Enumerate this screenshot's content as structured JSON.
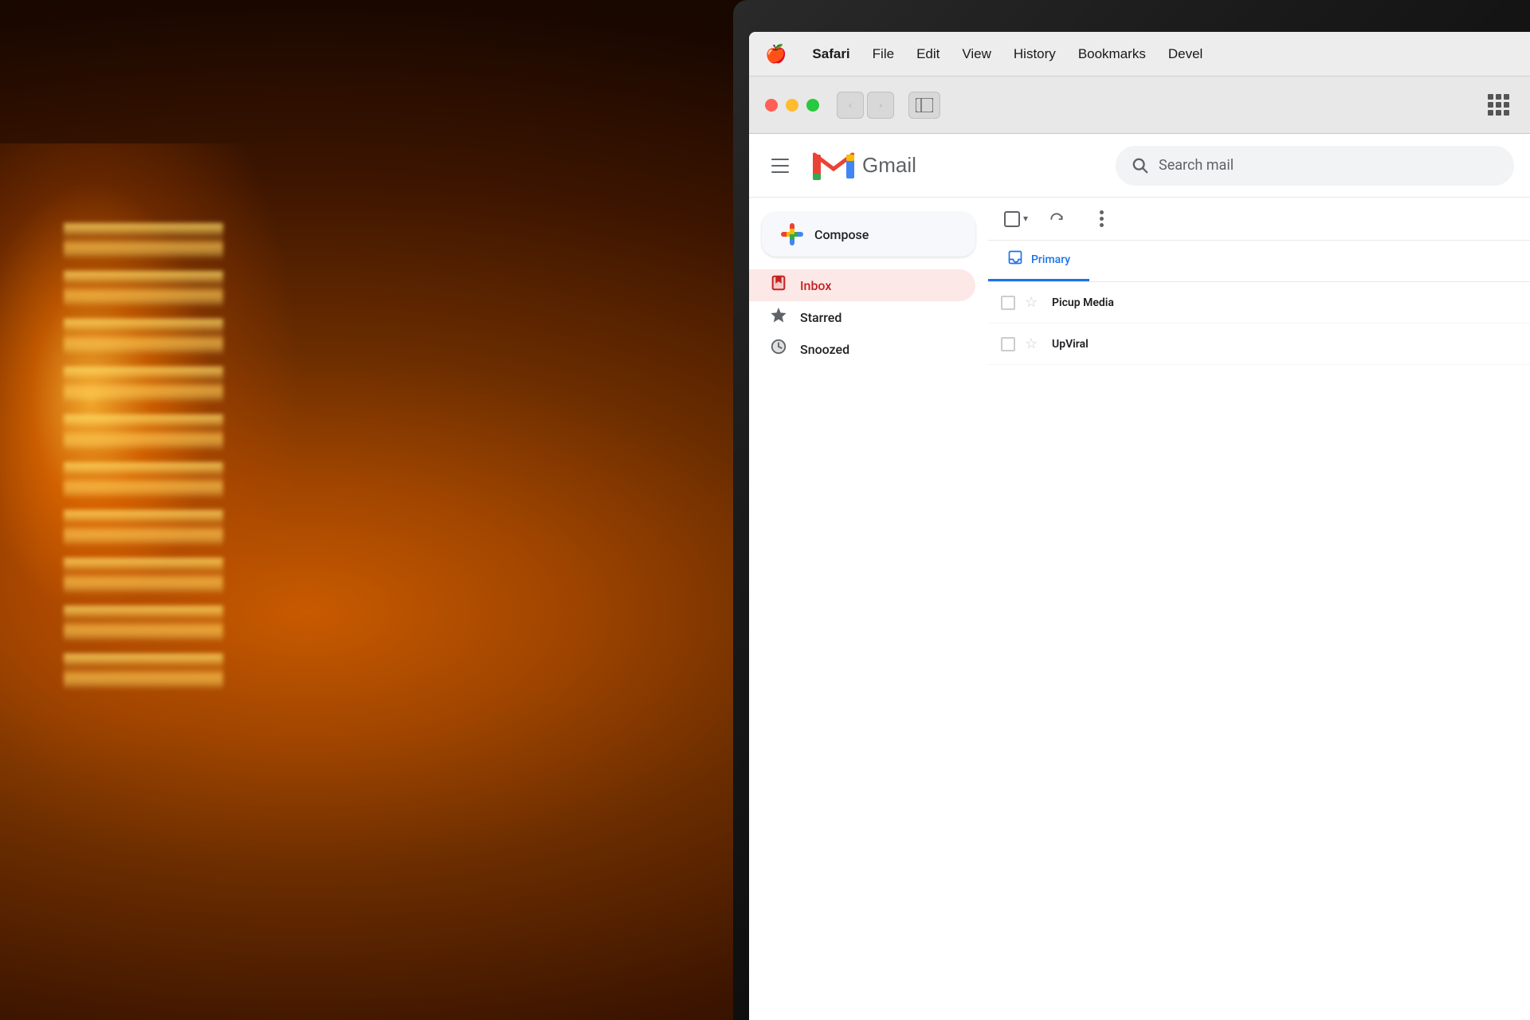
{
  "background": {
    "color": "#1a0a00"
  },
  "menubar": {
    "apple": "🍎",
    "items": [
      {
        "label": "Safari",
        "bold": true
      },
      {
        "label": "File"
      },
      {
        "label": "Edit"
      },
      {
        "label": "View"
      },
      {
        "label": "History"
      },
      {
        "label": "Bookmarks"
      },
      {
        "label": "Devel"
      }
    ]
  },
  "browser": {
    "back_label": "‹",
    "forward_label": "›",
    "sidebar_icon": "⊡",
    "grid_label": "⋮⋮⋮"
  },
  "gmail": {
    "hamburger_label": "≡",
    "logo_letter": "M",
    "wordmark": "Gmail",
    "search_placeholder": "Search mail",
    "compose_label": "Compose",
    "nav_items": [
      {
        "label": "Inbox",
        "icon": "🔖",
        "active": true
      },
      {
        "label": "Starred",
        "icon": "★",
        "active": false
      },
      {
        "label": "Snoozed",
        "icon": "🕐",
        "active": false
      }
    ],
    "tabs": [
      {
        "label": "Primary",
        "icon": "☐",
        "active": true
      }
    ],
    "emails": [
      {
        "sender": "Picup Media",
        "starred": false
      },
      {
        "sender": "UpViral",
        "starred": false
      }
    ]
  }
}
